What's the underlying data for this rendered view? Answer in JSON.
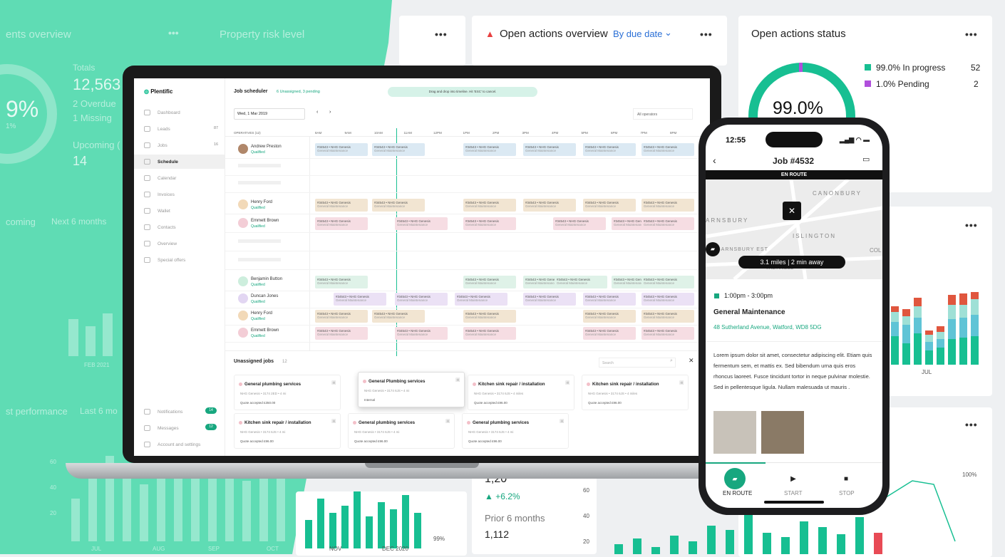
{
  "bg_cards": {
    "events_overview": {
      "title": "ents overview",
      "totals_label": "Totals",
      "totals_value": "12,563",
      "percent": "9%",
      "overdue": "2 Overdue",
      "missing": "1 Missing",
      "upcoming_label": "Upcoming (",
      "upcoming_value": "14",
      "small_pct": "1%"
    },
    "property_risk": {
      "title": "Property risk level"
    },
    "open_actions_overview": {
      "title": "Open actions overview",
      "filter": "By due date"
    },
    "open_actions_status": {
      "title": "Open actions status",
      "center": "99.0%",
      "legend": [
        {
          "label": "99.0% In progress",
          "count": "52",
          "color": "#17bf92"
        },
        {
          "label": "1.0% Pending",
          "count": "2",
          "color": "#b04fdc"
        }
      ]
    },
    "upcoming": {
      "title": "coming",
      "filter": "Next 6 months",
      "month": "FEB 2021"
    },
    "performance": {
      "title": "st performance",
      "filter": "Last 6 mo",
      "months": [
        "JUL",
        "AUG",
        "SEP",
        "OCT",
        "NOV",
        "DEC 2020"
      ],
      "pct": "99%",
      "y_ticks": [
        "60",
        "40",
        "20"
      ]
    },
    "prior": {
      "change": "+6.2%",
      "label": "Prior 6 months",
      "value": "1,112",
      "partial": "1,20",
      "y_ticks": [
        "60",
        "40",
        "20"
      ]
    },
    "right_chart": {
      "month": "JUL",
      "pct": "100%"
    }
  },
  "laptop": {
    "brand": "Plentific",
    "header": {
      "title": "Job scheduler",
      "sub": "6 Unassigned, 3 pending",
      "banner": "Drag and drop into timeline. Hit 'ESC' to cancel.",
      "date": "Wed, 1 Mar 2019",
      "operators": "All operators",
      "ops_label": "OPERATIVES (12)"
    },
    "nav": [
      {
        "label": "Dashboard",
        "badge": ""
      },
      {
        "label": "Leads",
        "badge": "87"
      },
      {
        "label": "Jobs",
        "badge": "16"
      },
      {
        "label": "Schedule",
        "badge": ""
      },
      {
        "label": "Calendar",
        "badge": ""
      },
      {
        "label": "Invoices",
        "badge": ""
      },
      {
        "label": "Wallet",
        "badge": ""
      },
      {
        "label": "Contacts",
        "badge": ""
      },
      {
        "label": "Overview",
        "badge": ""
      },
      {
        "label": "Special offers",
        "badge": ""
      }
    ],
    "nav_bottom": [
      {
        "label": "Notifications",
        "badge": "14"
      },
      {
        "label": "Messages",
        "badge": "12"
      },
      {
        "label": "Account and settings",
        "badge": ""
      }
    ],
    "times": [
      "8AM",
      "9AM",
      "10AM",
      "11AM",
      "12PM",
      "1PM",
      "2PM",
      "3PM",
      "4PM",
      "5PM",
      "6PM",
      "7PM",
      "8PM"
    ],
    "operatives": [
      {
        "name": "Andrew Preston",
        "status": "Qualified"
      },
      {
        "name": "Benjamin Button",
        "status": "Qualified"
      },
      {
        "name": "Duncan Jones",
        "status": "Qualified"
      },
      {
        "name": "Henry Ford",
        "status": "Qualified"
      },
      {
        "name": "Emmett Brown",
        "status": "Qualified"
      }
    ],
    "operatives_top": [
      {
        "name": "Henry Ford",
        "status": "Qualified"
      },
      {
        "name": "Emmett Brown",
        "status": "Qualified"
      }
    ],
    "chip_label": "#34543 • NHG Genesis",
    "chip_sub": "General Maintenance",
    "unassigned": {
      "title": "Unassigned jobs",
      "count": "12",
      "search": "Search"
    },
    "jobs": [
      {
        "title": "General plumbing services",
        "meta": "NHG Genesis • 3174 2ED • 4 mi",
        "quote": "Quote accepted £350.00"
      },
      {
        "title": "General Plumbing services",
        "meta": "NHG Genesis • 3174 6JS • 4 mi",
        "quote": "Internal"
      },
      {
        "title": "Kitchen sink repair / installation",
        "meta": "NHG Genesis • 3174 6JS • 4 miles",
        "quote": "Quote accepted £96.00"
      },
      {
        "title": "Kitchen sink repair / installation",
        "meta": "NHG Genesis • 3174 6JS • 4 miles",
        "quote": "Quote accepted £96.00"
      },
      {
        "title": "Kitchen sink repair / installation",
        "meta": "NHG Genesis • 3174 6JS • 4 mi",
        "quote": "Quote accepted £96.00"
      },
      {
        "title": "General plumbing services",
        "meta": "NHG Genesis • 3174 6JS • 4 mi",
        "quote": "Quote accepted £96.00"
      },
      {
        "title": "General plumbing services",
        "meta": "NHG Genesis • 3174 6JS • 4 mi",
        "quote": "Quote accepted £96.00"
      }
    ]
  },
  "phone": {
    "time": "12:55",
    "job": "Job #4532",
    "status_bar": "EN ROUTE",
    "map": {
      "canonbury": "CANONBURY",
      "islington": "ISLINGTON",
      "barnsbury": "ARNSBURY",
      "barnsbury2": "BARNSBURY EST",
      "angel": "THE ANGEL",
      "col": "COL",
      "distance": "3.1 miles",
      "eta": "2 min away"
    },
    "window": "1:00pm - 3:00pm",
    "title": "General Maintenance",
    "address": "48 Sutherland Avenue, Watford, WD8 5DG",
    "description": "Lorem ipsum dolor sit amet, consectetur adipiscing elit. Etiam quis fermentum sem, et mattis ex. Sed bibendum urna quis eros rhoncus laoreet. Fusce tincidunt tortor in neque pulvinar molestie. Sed in pellentesque ligula. Nullam malesuada ut mauris .",
    "buttons": {
      "enroute": "EN ROUTE",
      "start": "START",
      "stop": "STOP"
    }
  }
}
